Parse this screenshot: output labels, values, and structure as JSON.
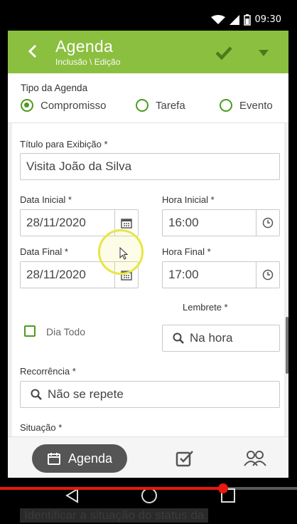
{
  "status_bar": {
    "time": "09:30"
  },
  "header": {
    "title": "Agenda",
    "subtitle": "Inclusão \\ Edição",
    "back_icon": "chevron-left-icon",
    "confirm_icon": "check-icon",
    "menu_icon": "caret-down-icon"
  },
  "tipo": {
    "label": "Tipo da Agenda",
    "options": [
      {
        "label": "Compromisso",
        "selected": true
      },
      {
        "label": "Tarefa",
        "selected": false
      },
      {
        "label": "Evento",
        "selected": false
      }
    ]
  },
  "form": {
    "titulo": {
      "label": "Título para Exibição *",
      "value": "Visita João da Silva"
    },
    "data_inicial": {
      "label": "Data Inicial *",
      "value": "28/11/2020"
    },
    "hora_inicial": {
      "label": "Hora Inicial *",
      "value": "16:00"
    },
    "data_final": {
      "label": "Data Final *",
      "value": "28/11/2020"
    },
    "hora_final": {
      "label": "Hora Final *",
      "value": "17:00"
    },
    "dia_todo": {
      "label": "Dia Todo",
      "checked": false
    },
    "lembrete": {
      "label": "Lembrete *",
      "value": "Na hora"
    },
    "recorrencia": {
      "label": "Recorrência *",
      "value": "Não se repete"
    },
    "situacao": {
      "label": "Situação *"
    }
  },
  "tabs": {
    "agenda_label": "Agenda"
  },
  "video": {
    "progress_fraction": 0.75,
    "caption": "Identificar a situação do status da"
  },
  "colors": {
    "header_bg": "#8bbf3f",
    "accent_green": "#4e9a1f",
    "tab_active_bg": "#555555",
    "progress_red": "#e8190e"
  }
}
